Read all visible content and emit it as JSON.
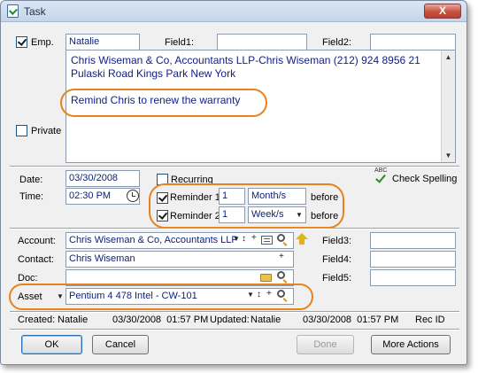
{
  "window": {
    "title": "Task",
    "close_label": "X"
  },
  "header": {
    "emp_checked": true,
    "emp_label": "Emp.",
    "emp_value": "Natalie",
    "field1_label": "Field1:",
    "field1_value": "",
    "field2_label": "Field2:",
    "field2_value": "",
    "private_label": "Private",
    "private_checked": false
  },
  "notes": {
    "text": "Chris Wiseman & Co, Accountants LLP-Chris Wiseman (212) 924 8956  21 Pulaski Road Kings Park  New York",
    "reminder_text": "Remind Chris to renew the warranty"
  },
  "schedule": {
    "date_label": "Date:",
    "date_value": "03/30/2008",
    "time_label": "Time:",
    "time_value": "02:30 PM",
    "recurring_label": "Recurring",
    "recurring_checked": false,
    "spell_label": "Check Spelling",
    "reminder1": {
      "label": "Reminder 1:",
      "checked": true,
      "value": "1",
      "unit": "Month/s",
      "suffix": "before"
    },
    "reminder2": {
      "label": "Reminder 2:",
      "checked": true,
      "value": "1",
      "unit": "Week/s",
      "suffix": "before"
    }
  },
  "links": {
    "account_label": "Account:",
    "account_value": "Chris Wiseman & Co, Accountants LLP",
    "contact_label": "Contact:",
    "contact_value": "Chris Wiseman",
    "doc_label": "Doc:",
    "doc_value": "",
    "asset_label": "Asset",
    "asset_value": "Pentium 4 478 Intel - CW-101",
    "field3_label": "Field3:",
    "field4_label": "Field4:",
    "field5_label": "Field5:",
    "field3_value": "",
    "field4_value": "",
    "field5_value": "",
    "plus_glyph": "+",
    "sort_glyph": "↕"
  },
  "status": {
    "created_label": "Created:",
    "created_by": "Natalie",
    "created_at": "03/30/2008  01:57 PM",
    "updated_label": "Updated:",
    "updated_by": "Natalie",
    "updated_at": "03/30/2008  01:57 PM",
    "rec_id_label": "Rec ID"
  },
  "buttons": {
    "ok": "OK",
    "cancel": "Cancel",
    "done": "Done",
    "more": "More Actions"
  },
  "colors": {
    "highlight_oval": "#e8821c",
    "field_text": "#12208a"
  }
}
